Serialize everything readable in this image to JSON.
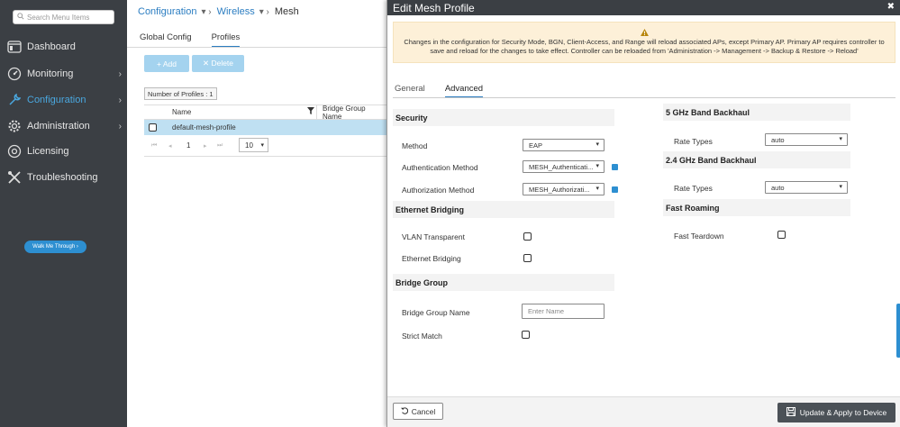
{
  "sidebar": {
    "search_placeholder": "Search Menu Items",
    "items": [
      {
        "label": "Dashboard"
      },
      {
        "label": "Monitoring"
      },
      {
        "label": "Configuration"
      },
      {
        "label": "Administration"
      },
      {
        "label": "Licensing"
      },
      {
        "label": "Troubleshooting"
      }
    ],
    "walk_me": "Walk Me Through ›"
  },
  "breadcrumb": {
    "items": [
      "Configuration",
      "Wireless"
    ],
    "current": "Mesh"
  },
  "main": {
    "tabs": [
      "Global Config",
      "Profiles"
    ],
    "active_tab": "Profiles",
    "add_label": "+ Add",
    "delete_label": "✕ Delete",
    "profile_count": "Number of Profiles : 1",
    "columns": [
      "Name",
      "Bridge Group Name"
    ],
    "rows": [
      {
        "name": "default-mesh-profile",
        "bridge_group": ""
      }
    ],
    "pager": {
      "page": "1",
      "page_size": "10"
    }
  },
  "modal": {
    "title": "Edit Mesh Profile",
    "warning_line1": "Changes in the configuration for Security Mode, BGN, Client-Access, and Range will reload associated APs, except Primary AP. Primary AP requires controller to",
    "warning_line2": "save and reload for the changes to take effect. Controller can be reloaded from 'Administration -> Management -> Backup & Restore -> Reload'",
    "tabs": [
      "General",
      "Advanced"
    ],
    "active_tab": "Advanced",
    "security": {
      "heading": "Security",
      "method_label": "Method",
      "method_value": "EAP",
      "auth_label": "Authentication Method",
      "auth_value": "MESH_Authenticati...",
      "authz_label": "Authorization Method",
      "authz_value": "MESH_Authorizati..."
    },
    "ethernet": {
      "heading": "Ethernet Bridging",
      "vlan_label": "VLAN Transparent",
      "vlan_checked": false,
      "eb_label": "Ethernet Bridging",
      "eb_checked": false
    },
    "bridge_group": {
      "heading": "Bridge Group",
      "name_label": "Bridge Group Name",
      "name_placeholder": "Enter Name",
      "strict_label": "Strict Match",
      "strict_checked": false
    },
    "band5": {
      "heading": "5 GHz Band Backhaul",
      "rate_label": "Rate Types",
      "rate_value": "auto"
    },
    "band24": {
      "heading": "2.4 GHz Band Backhaul",
      "rate_label": "Rate Types",
      "rate_value": "auto"
    },
    "roaming": {
      "heading": "Fast Roaming",
      "teardown_label": "Fast Teardown",
      "teardown_checked": false
    },
    "cancel_label": "Cancel",
    "apply_label": "Update & Apply to Device"
  },
  "colors": {
    "sidebar_bg": "#3b3f44",
    "accent": "#2b7dc1",
    "active_nav": "#4aa8e0",
    "warning_bg": "#fdf0d8",
    "warning_icon": "#b8860b"
  }
}
